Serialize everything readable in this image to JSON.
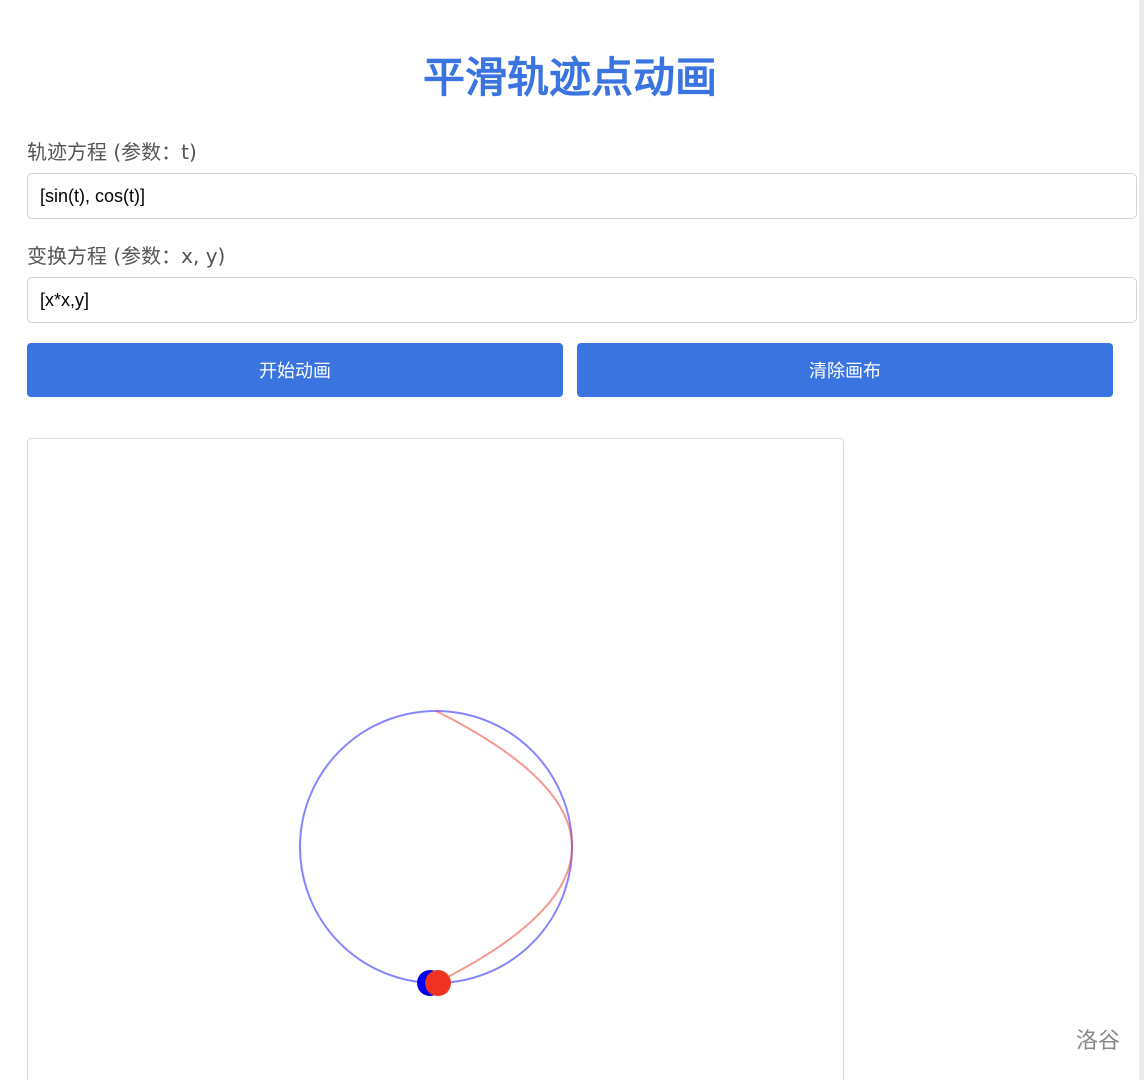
{
  "title": "平滑轨迹点动画",
  "trajectory": {
    "label": "轨迹方程 (参数：t)",
    "value": "[sin(t), cos(t)]"
  },
  "transform": {
    "label": "变换方程 (参数：x, y)",
    "value": "[x*x,y]"
  },
  "buttons": {
    "start_label": "开始动画",
    "clear_label": "清除画布"
  },
  "canvas": {
    "original_color": "#3333ff",
    "transformed_color": "#ee3322",
    "original_point_color": "#0000ee",
    "transformed_point_color": "#ee3322"
  },
  "watermark": "洛谷",
  "colors": {
    "accent": "#3a74e0"
  }
}
